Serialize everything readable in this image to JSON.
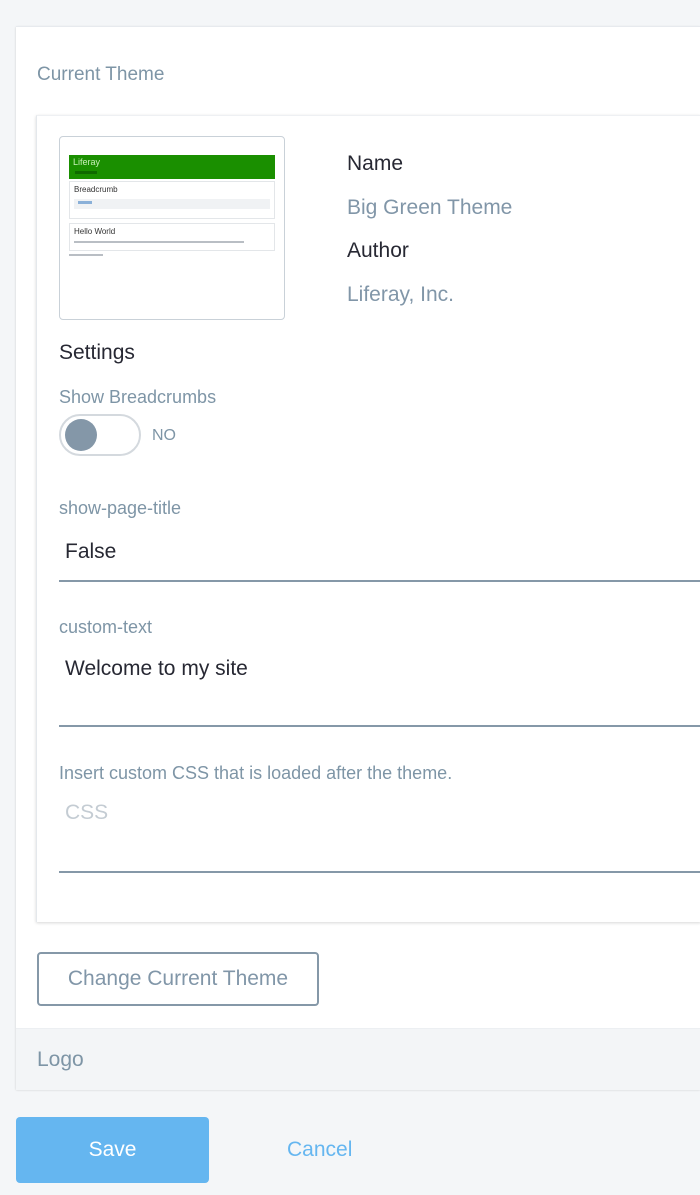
{
  "current_theme": {
    "section_title": "Current Theme",
    "thumbnail": {
      "logo_text": "Liferay",
      "breadcrumb_title": "Breadcrumb",
      "content_title": "Hello World"
    },
    "name_label": "Name",
    "name_value": "Big Green Theme",
    "author_label": "Author",
    "author_value": "Liferay, Inc.",
    "settings_title": "Settings",
    "show_breadcrumbs_label": "Show Breadcrumbs",
    "show_breadcrumbs_state": "NO",
    "show_page_title_label": "show-page-title",
    "show_page_title_value": "False",
    "custom_text_label": "custom-text",
    "custom_text_value": "Welcome to my site",
    "css_label": "Insert custom CSS that is loaded after the theme.",
    "css_placeholder": "CSS",
    "change_button": "Change Current Theme"
  },
  "logo_section": {
    "title": "Logo"
  },
  "actions": {
    "save": "Save",
    "cancel": "Cancel"
  },
  "colors": {
    "accent": "#65b6f0",
    "theme_green": "#1a8f00",
    "muted_text": "#7e95a6"
  }
}
